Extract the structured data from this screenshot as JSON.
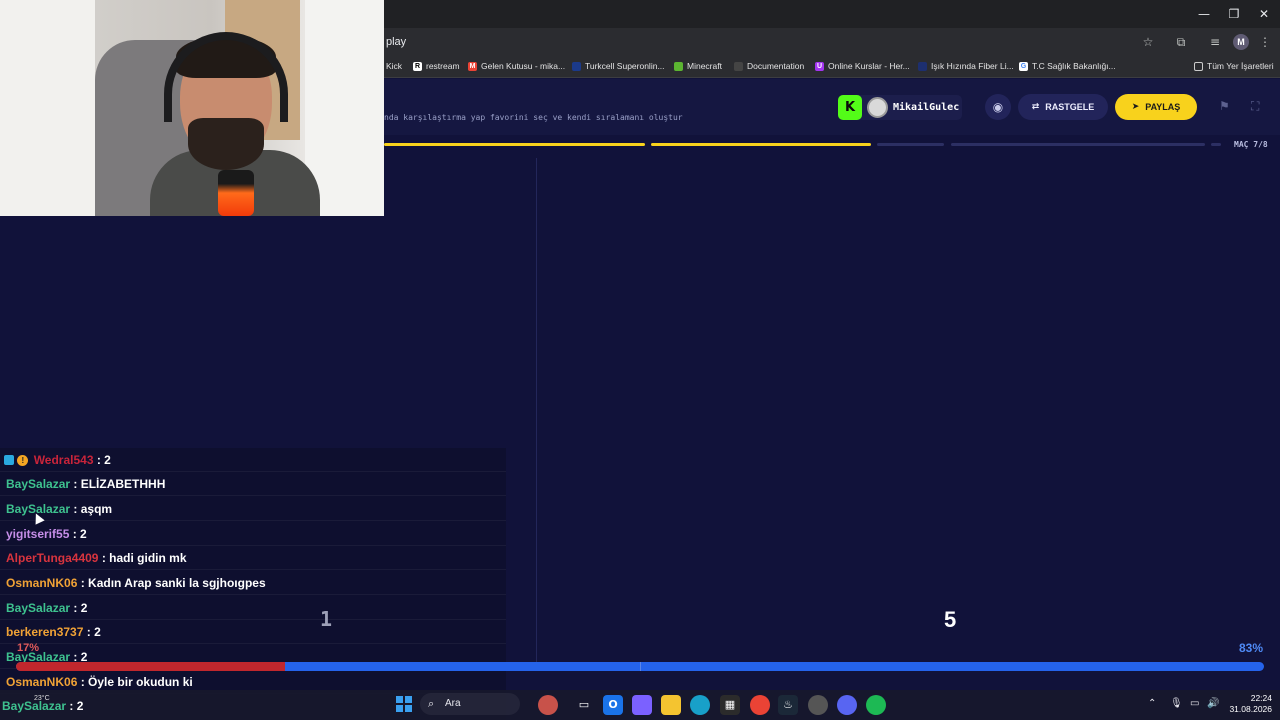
{
  "browser": {
    "url": "play",
    "window_controls": {
      "minimize": "—",
      "maximize": "❐",
      "close": "✕"
    },
    "toolbar_icons": [
      "star-icon",
      "extensions-icon",
      "tab-search-icon",
      "profile-avatar",
      "menu-icon"
    ],
    "profile_initial": "M",
    "bookmarks": [
      {
        "label": "Kick",
        "icon": "kick"
      },
      {
        "label": "restream",
        "icon": "restream"
      },
      {
        "label": "Gelen Kutusu - mika...",
        "icon": "gmail"
      },
      {
        "label": "Turkcell Superonlin...",
        "icon": "turkcell"
      },
      {
        "label": "Minecraft",
        "icon": "minecraft"
      },
      {
        "label": "Documentation",
        "icon": "doc"
      },
      {
        "label": "Online Kurslar - Her...",
        "icon": "udemy"
      },
      {
        "label": "Işık Hızında Fiber Li...",
        "icon": "fiber"
      },
      {
        "label": "T.C Sağlık Bakanlığı...",
        "icon": "google"
      }
    ],
    "all_bookmarks": "Tüm Yer İşaretleri"
  },
  "header": {
    "tagline": "nda karşılaştırma yap favorini seç ve kendi sıralamanı oluştur",
    "kick_user": "MikailGulec",
    "random_label": "RASTGELE",
    "share_label": "PAYLAŞ",
    "match_counter": "MAÇ 7/8"
  },
  "progress_steps": [
    {
      "state": "done",
      "color": "#f8d21c"
    },
    {
      "state": "done",
      "color": "#f8d21c"
    },
    {
      "state": "pending",
      "color": "#2c2f63"
    },
    {
      "state": "pending",
      "color": "#2c2f63"
    },
    {
      "state": "pending",
      "color": "#2c2f63"
    }
  ],
  "vote": {
    "left_rank": "1",
    "right_rank": "5",
    "left_percent": "17%",
    "right_percent": "83%",
    "left_fraction": 0.17
  },
  "chat": [
    {
      "user": "Wedral543",
      "message": ": 2",
      "color": "#c9243a",
      "badges": true
    },
    {
      "user": "BaySalazar",
      "message": ": ELİZABETHHH",
      "color": "#3ec28f"
    },
    {
      "user": "BaySalazar",
      "message": ": aşqm",
      "color": "#3ec28f"
    },
    {
      "user": "yigitserif55",
      "message": ": 2",
      "color": "#c68ee8"
    },
    {
      "user": "AlperTunga4409",
      "message": ": hadi gidin mk",
      "color": "#d8343e"
    },
    {
      "user": "OsmanNK06",
      "message": ": Kadın Arap sanki la sgjhoıgpes",
      "color": "#f0a236"
    },
    {
      "user": "BaySalazar",
      "message": ": 2",
      "color": "#3ec28f"
    },
    {
      "user": "berkeren3737",
      "message": ": 2",
      "color": "#f0a236"
    },
    {
      "user": "BaySalazar",
      "message": ": 2",
      "color": "#3ec28f"
    },
    {
      "user": "OsmanNK06",
      "message": ": Öyle bir okudun ki",
      "color": "#f0a236"
    },
    {
      "user": "BaySalazar",
      "message": ": 2",
      "color": "#3ec28f"
    }
  ],
  "taskbar": {
    "search_placeholder": "Ara",
    "weather": "23°C",
    "time": "22:24",
    "date": "31.08.2026",
    "apps": [
      "widgets",
      "task-view",
      "outlook",
      "copilot",
      "file-explorer",
      "edge",
      "store",
      "chrome",
      "steam",
      "feedback",
      "discord",
      "spotify"
    ]
  }
}
